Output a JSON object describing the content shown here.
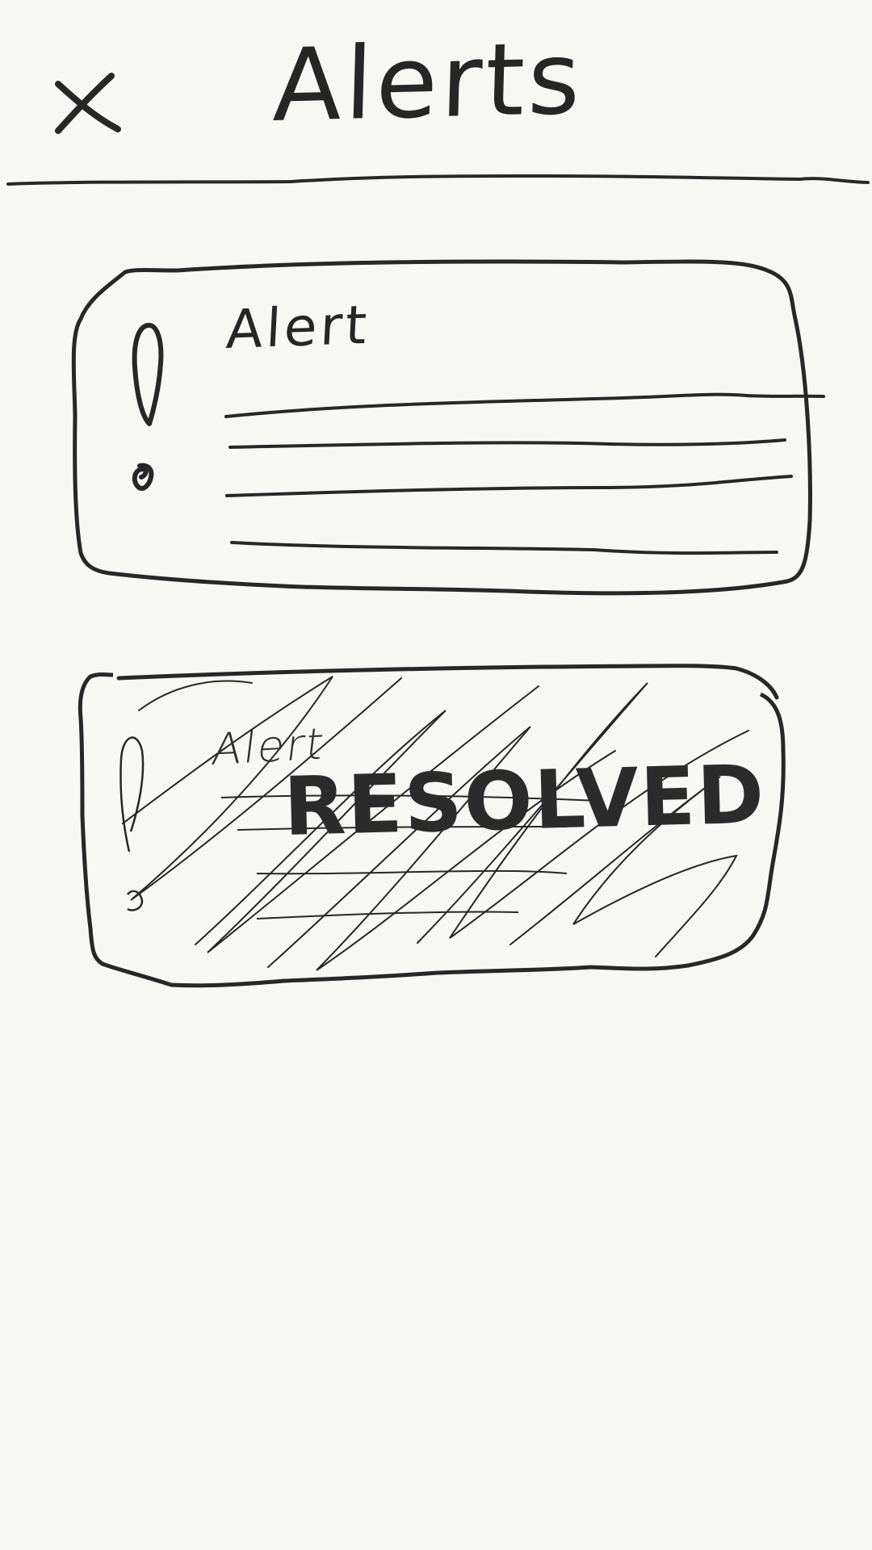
{
  "header": {
    "title": "Alerts",
    "close_icon": "close-icon"
  },
  "alerts": [
    {
      "title": "Alert",
      "icon": "exclamation-icon",
      "status": "active",
      "body_lines": 4
    },
    {
      "title": "Alert",
      "icon": "exclamation-icon",
      "status": "resolved",
      "stamp": "RESOLVED",
      "body_lines": 4
    }
  ],
  "colors": {
    "background": "#f7f7f3",
    "ink": "#272727"
  }
}
